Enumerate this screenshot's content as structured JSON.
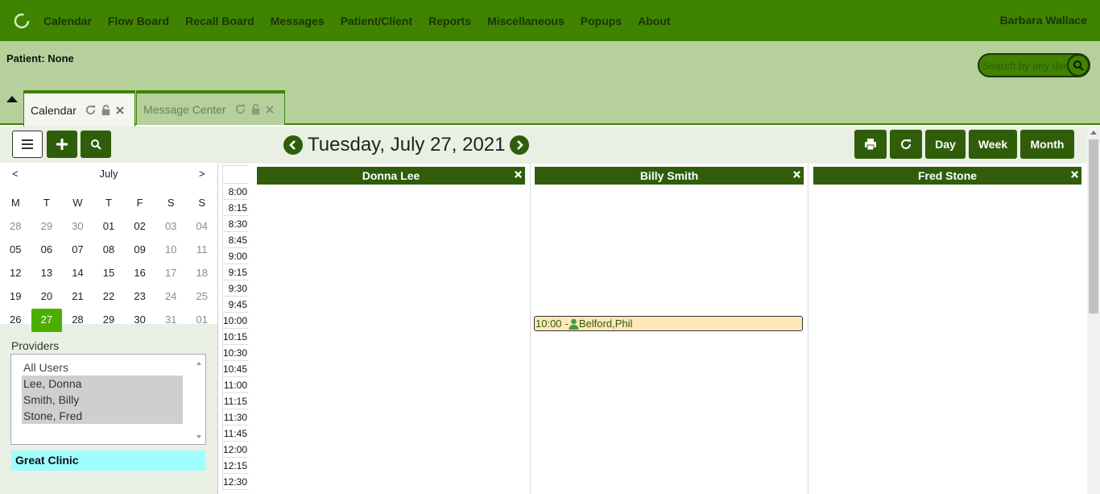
{
  "nav": {
    "items": [
      "Calendar",
      "Flow Board",
      "Recall Board",
      "Messages",
      "Patient/Client",
      "Reports",
      "Miscellaneous",
      "Popups",
      "About"
    ],
    "user": "Barbara Wallace"
  },
  "patient": {
    "label": "Patient: None"
  },
  "search": {
    "placeholder": "Search by any demographics"
  },
  "tabs": [
    {
      "label": "Calendar",
      "active": true
    },
    {
      "label": "Message Center",
      "active": false
    }
  ],
  "date_title": "Tuesday, July 27, 2021",
  "view_buttons": {
    "day": "Day",
    "week": "Week",
    "month": "Month"
  },
  "mini_calendar": {
    "prev": "<",
    "month": "July",
    "next": ">",
    "dow": [
      "M",
      "T",
      "W",
      "T",
      "F",
      "S",
      "S"
    ],
    "weeks": [
      [
        "28",
        "29",
        "30",
        "01",
        "02",
        "03",
        "04"
      ],
      [
        "05",
        "06",
        "07",
        "08",
        "09",
        "10",
        "11"
      ],
      [
        "12",
        "13",
        "14",
        "15",
        "16",
        "17",
        "18"
      ],
      [
        "19",
        "20",
        "21",
        "22",
        "23",
        "24",
        "25"
      ],
      [
        "26",
        "27",
        "28",
        "29",
        "30",
        "31",
        "01"
      ]
    ],
    "selected": "27"
  },
  "providers": {
    "title": "Providers",
    "options": [
      "All Users",
      "Lee, Donna",
      "Smith, Billy",
      "Stone, Fred"
    ],
    "selected": [
      "Lee, Donna",
      "Smith, Billy",
      "Stone, Fred"
    ]
  },
  "facility": "Great Clinic",
  "times": [
    "8:00",
    "8:15",
    "8:30",
    "8:45",
    "9:00",
    "9:15",
    "9:30",
    "9:45",
    "10:00",
    "10:15",
    "10:30",
    "10:45",
    "11:00",
    "11:15",
    "11:30",
    "11:45",
    "12:00",
    "12:15",
    "12:30"
  ],
  "columns": [
    "Donna Lee",
    "Billy Smith",
    "Fred Stone"
  ],
  "appointment": {
    "time": "10:00",
    "dash": "-",
    "patient": "Belford,Phil",
    "provider": "Billy Smith"
  },
  "colors": {
    "primary": "#3f8300",
    "dark": "#2f5d0a",
    "bar": "#b5d09b",
    "appointment": "#fde8b8",
    "facility": "#9ffefe",
    "today": "#4caf00"
  }
}
